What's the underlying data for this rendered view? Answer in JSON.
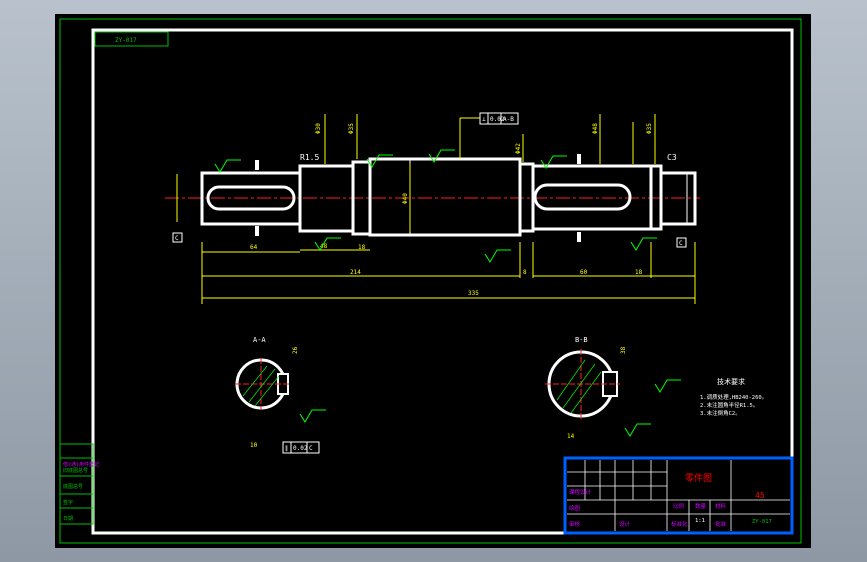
{
  "drawing_code": "ZY-017",
  "drawing_code_footer": "ZY-017",
  "title_block": {
    "title": "零件图",
    "scale_header": "比例",
    "quantity_header": "数量",
    "material_header": "材料",
    "scale_value": "1:1",
    "material_value": "45",
    "drawn": "绘图",
    "checked": "审核",
    "school": "课程设计",
    "designer_label": "设计",
    "standard_label": "标准化",
    "batch_label": "批准"
  },
  "side_table": [
    "借(通)用件登记",
    "旧底图总号",
    "底图总号",
    "签字",
    "日期"
  ],
  "dimensions": {
    "d1": "Φ30",
    "d2": "Φ35",
    "d3": "Φ40",
    "d4": "Φ42",
    "d5": "Φ48",
    "d6": "Φ35",
    "len_a": "48",
    "len_b": "64",
    "len_c": "18",
    "len_d": "214",
    "len_e": "8",
    "len_f": "60",
    "len_g": "18",
    "total": "335",
    "chamfer_left": "R1.5",
    "chamfer_right": "C3",
    "tol_box": [
      "⊥",
      "0.02",
      "A-B"
    ],
    "datum_left": "C",
    "datum_right": "C"
  },
  "sections": {
    "aa_label": "A-A",
    "bb_label": "B-B",
    "aa_depth": "26",
    "bb_depth": "38",
    "aa_width": "10",
    "bb_width": "14",
    "aa_tol": [
      "∥",
      "0.02",
      "C"
    ]
  },
  "notes": {
    "heading": "技术要求",
    "lines": [
      "1.调质处理,HB240-260。",
      "2.未注圆角半径R1.5。",
      "3.未注倒角C2。"
    ]
  }
}
